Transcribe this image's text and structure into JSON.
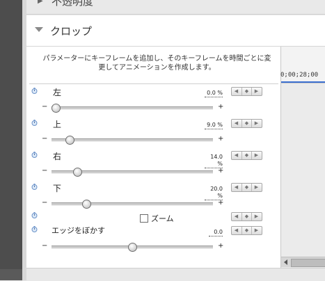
{
  "sections": {
    "opacity_title": "不透明度",
    "crop_title": "クロップ"
  },
  "info_text": "パラメーターにキーフレームを追加し、そのキーフレームを時間ごとに変更してアニメーションを作成します。",
  "params": [
    {
      "label": "左",
      "value": "0.0 %",
      "level_fraction": 0.0
    },
    {
      "label": "上",
      "value": "9.0 %",
      "level_fraction": 0.09
    },
    {
      "label": "右",
      "value": "14.0 %",
      "level_fraction": 0.14
    },
    {
      "label": "下",
      "value": "20.0 %",
      "level_fraction": 0.2
    }
  ],
  "zoom_label": "ズーム",
  "feather": {
    "label": "エッジをぼかす",
    "value": "0.0",
    "level_fraction": 0.5
  },
  "slider_minus": "−",
  "slider_plus": "+",
  "keyframe_buttons": {
    "prev": "◀",
    "add": "◆",
    "next": "▶"
  },
  "timeline": {
    "timecode": "0;00;28;00"
  },
  "colors": {
    "timeline_marker": "#3b6fd0",
    "panel_bg": "#ffffff"
  }
}
